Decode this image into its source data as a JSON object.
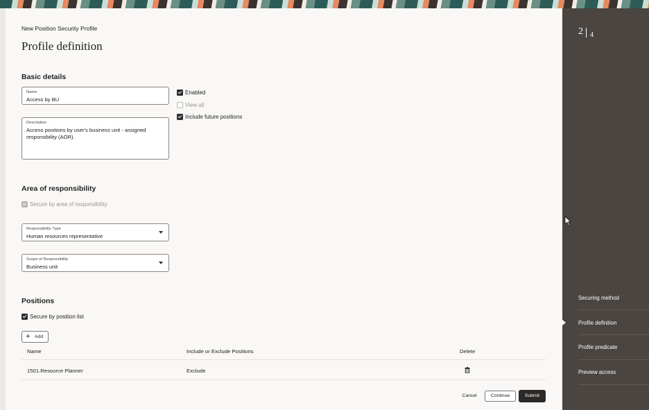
{
  "header": {
    "breadcrumb": "New Position Security Profile",
    "title": "Profile definition"
  },
  "basic": {
    "heading": "Basic details",
    "name_label": "Name",
    "name_value": "Access by BU",
    "description_label": "Description",
    "description_value": "Access positions by user's business unit - assigned responsibility (AOR).",
    "enabled_label": "Enabled",
    "enabled_checked": true,
    "view_all_label": "View all",
    "view_all_checked": false,
    "future_label": "Include future positions",
    "future_checked": true
  },
  "aor": {
    "heading": "Area of responsibility",
    "secure_label": "Secure by area of responsibility",
    "secure_checked": true,
    "responsibility_type_label": "Responsibility Type",
    "responsibility_type_value": "Human resources representative",
    "scope_label": "Scope of Responsibility",
    "scope_value": "Business unit"
  },
  "positions": {
    "heading": "Positions",
    "secure_label": "Secure by position list",
    "secure_checked": true,
    "add_label": "Add",
    "columns": [
      "Name",
      "Include or Exclude Positions",
      "Delete"
    ],
    "rows": [
      {
        "name": "1501.Resource Planner",
        "mode": "Exclude"
      }
    ]
  },
  "footer": {
    "cancel": "Cancel",
    "continue": "Continue",
    "submit": "Submit"
  },
  "sidebar": {
    "current_step": "2",
    "total_steps": "4",
    "steps": [
      "Securing method",
      "Profile definition",
      "Profile predicate",
      "Preview access"
    ],
    "active_step": "Profile definition"
  },
  "colors": {
    "sidebar_bg": "#4a4541",
    "submit_bg": "#2b2927",
    "page_bg": "#f9f8f6"
  }
}
